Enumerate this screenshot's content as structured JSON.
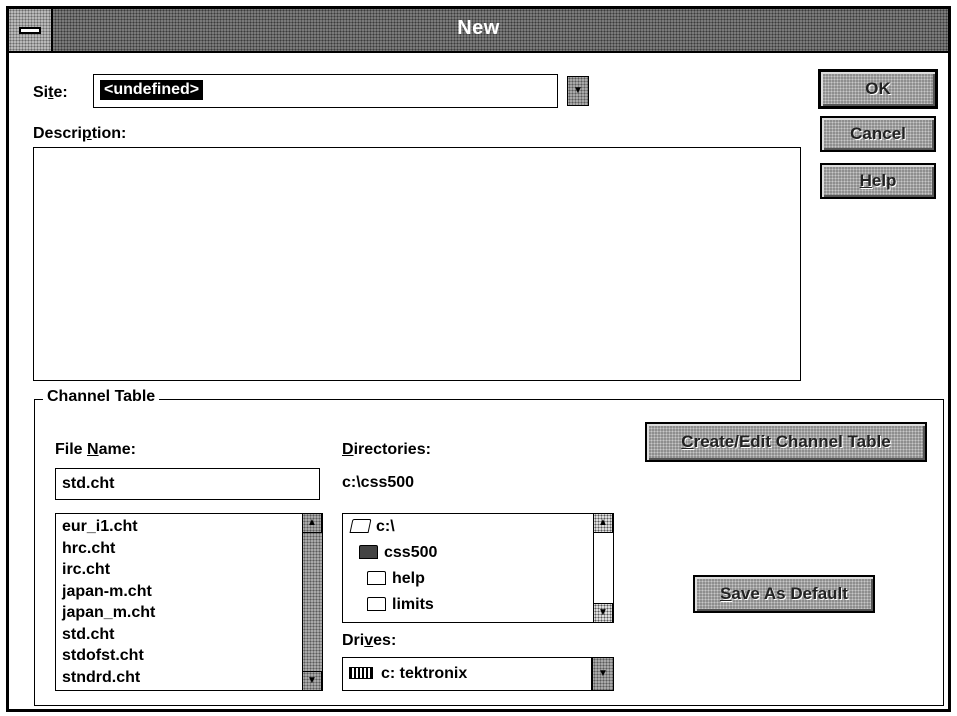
{
  "window": {
    "title": "New"
  },
  "site": {
    "label_pre": "Si",
    "label_accel": "t",
    "label_post": "e:",
    "value": "<undefined>"
  },
  "description": {
    "label_pre": "Descri",
    "label_accel": "p",
    "label_post": "tion:"
  },
  "buttons": {
    "ok": "OK",
    "cancel": "Cancel",
    "help_accel": "H",
    "help_rest": "elp",
    "create_accel": "C",
    "create_rest": "reate/Edit Channel Table",
    "save_accel": "S",
    "save_rest": "ave As Default"
  },
  "channel_table": {
    "group_label": "Channel Table",
    "file_name_label_pre": "File ",
    "file_name_label_accel": "N",
    "file_name_label_post": "ame:",
    "file_name_value": "std.cht",
    "files": [
      "eur_i1.cht",
      "hrc.cht",
      "irc.cht",
      "japan-m.cht",
      "japan_m.cht",
      "std.cht",
      "stdofst.cht",
      "stndrd.cht"
    ],
    "directories_label_accel": "D",
    "directories_label_rest": "irectories:",
    "current_dir": "c:\\css500",
    "dirs": [
      "c:\\",
      "css500",
      "help",
      "limits"
    ],
    "drives_label_pre": "Dri",
    "drives_label_accel": "v",
    "drives_label_post": "es:",
    "drive_value": "c: tektronix"
  },
  "icons": {
    "system_menu": "system-menu-icon",
    "dropdown": "down-arrow-icon",
    "scroll_up": "up-arrow-icon",
    "scroll_down": "down-arrow-icon",
    "folder_open": "open-folder-icon",
    "folder": "folder-icon",
    "drive": "hard-drive-icon"
  }
}
